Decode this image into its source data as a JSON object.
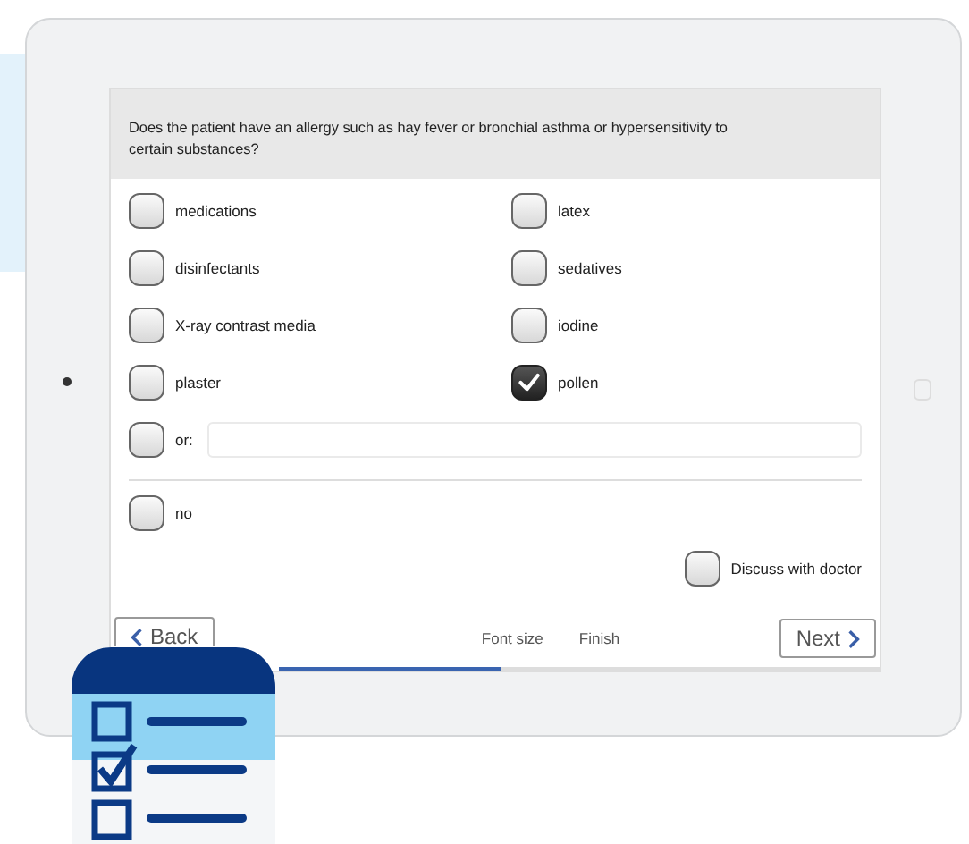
{
  "question": "Does the patient have an allergy such as hay fever or bronchial asthma or hypersensitivity to certain substances?",
  "options": [
    {
      "label": "medications",
      "checked": false
    },
    {
      "label": "latex",
      "checked": false
    },
    {
      "label": "disinfectants",
      "checked": false
    },
    {
      "label": "sedatives",
      "checked": false
    },
    {
      "label": "X-ray contrast media",
      "checked": false
    },
    {
      "label": "iodine",
      "checked": false
    },
    {
      "label": "plaster",
      "checked": false
    },
    {
      "label": "pollen",
      "checked": true
    }
  ],
  "other": {
    "label": "or:",
    "checked": false
  },
  "none_option": {
    "label": "no",
    "checked": false
  },
  "discuss": {
    "label": "Discuss with doctor",
    "checked": false
  },
  "nav": {
    "back": "Back",
    "links": [
      "Font size",
      "Finish"
    ],
    "next": "Next"
  },
  "progress": {
    "level": 0.37
  }
}
